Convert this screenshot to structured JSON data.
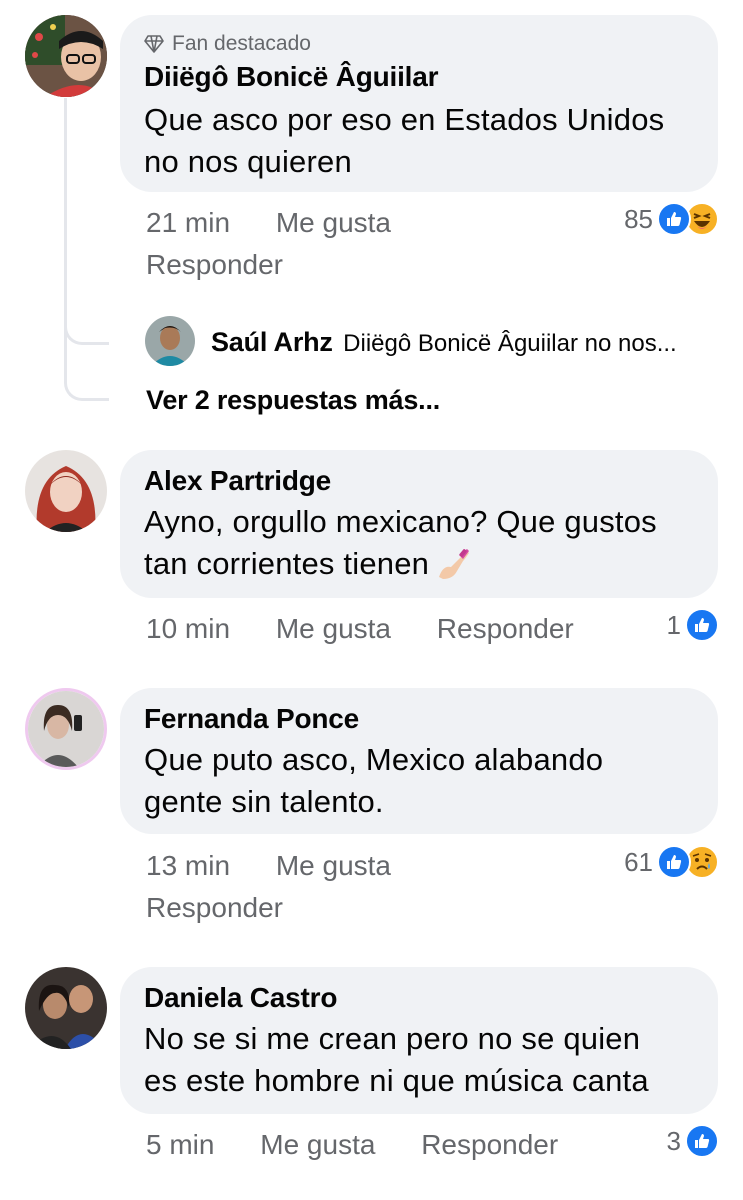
{
  "colors": {
    "bubble": "#f0f2f5",
    "meta": "#65676b",
    "like_blue": "#1877f2",
    "emoji_yellow": "#f7b125"
  },
  "comments": [
    {
      "badge": "Fan destacado",
      "author": "Diiëgô Bonicë Âguiilar",
      "text_line1": "Que asco por eso en Estados Unidos",
      "text_line2": "no nos quieren",
      "time": "21 min",
      "like": "Me gusta",
      "reply": "Responder",
      "reaction_count": "85",
      "reactions": [
        "like-icon",
        "haha-icon"
      ],
      "replies": {
        "author": "Saúl Arhz",
        "preview": "Diiëgô Bonicë Âguiilar no nos...",
        "more": "Ver 2 respuestas más..."
      }
    },
    {
      "author": "Alex Partridge",
      "text_line1": "Ayno, orgullo mexicano? Que gustos",
      "text_line2": "tan corrientes tienen",
      "emoji": "nail-polish-icon",
      "time": "10 min",
      "like": "Me gusta",
      "reply": "Responder",
      "reaction_count": "1",
      "reactions": [
        "like-icon"
      ]
    },
    {
      "author": "Fernanda Ponce",
      "text_line1": "Que puto asco, Mexico alabando",
      "text_line2": "gente sin talento.",
      "time": "13 min",
      "like": "Me gusta",
      "reply": "Responder",
      "reaction_count": "61",
      "reactions": [
        "like-icon",
        "sad-icon"
      ]
    },
    {
      "author": "Daniela Castro",
      "text_line1": "No se si me crean pero no se quien",
      "text_line2": "es este hombre ni que música canta",
      "time": "5 min",
      "like": "Me gusta",
      "reply": "Responder",
      "reaction_count": "3",
      "reactions": [
        "like-icon"
      ]
    }
  ]
}
